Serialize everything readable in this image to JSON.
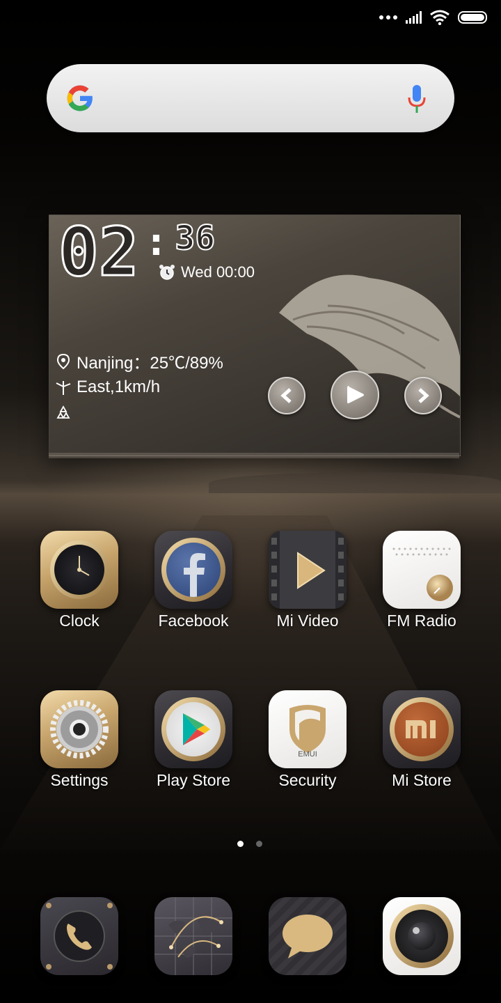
{
  "status_bar": {
    "signal_icon": "cellular-signal-icon",
    "wifi_icon": "wifi-icon",
    "battery_icon": "battery-full-icon"
  },
  "search": {
    "logo": "google-g-icon",
    "mic_icon": "microphone-icon"
  },
  "widget": {
    "hour": "02",
    "minute": "36",
    "alarm_icon": "alarm-clock-icon",
    "alarm_text": "Wed 00:00",
    "location_icon": "location-pin-icon",
    "weather_text": "Nanjing：25℃/89%",
    "wind_icon": "wind-turbine-icon",
    "wind_text": "East,1km/h",
    "recycle_icon": "recycle-icon",
    "controls": [
      "previous-icon",
      "play-icon",
      "next-icon"
    ]
  },
  "apps_row1": [
    {
      "label": "Clock",
      "icon": "clock-icon"
    },
    {
      "label": "Facebook",
      "icon": "facebook-icon"
    },
    {
      "label": "Mi Video",
      "icon": "video-play-icon"
    },
    {
      "label": "FM Radio",
      "icon": "radio-icon"
    }
  ],
  "apps_row2": [
    {
      "label": "Settings",
      "icon": "gear-icon"
    },
    {
      "label": "Play Store",
      "icon": "play-store-icon"
    },
    {
      "label": "Security",
      "icon": "shield-icon",
      "badge_text": "EMUI"
    },
    {
      "label": "Mi Store",
      "icon": "mi-logo-icon",
      "logo_text": "mi"
    }
  ],
  "pager": {
    "pages": 2,
    "active": 1
  },
  "dock": [
    {
      "icon": "phone-icon"
    },
    {
      "icon": "browser-globe-icon"
    },
    {
      "icon": "messages-icon"
    },
    {
      "icon": "camera-icon"
    }
  ],
  "colors": {
    "gold": "#c7a46b",
    "dark_icon": "#2d2b30",
    "google_blue": "#4285F4",
    "google_red": "#EA4335",
    "google_yellow": "#FBBC05",
    "google_green": "#34A853"
  }
}
